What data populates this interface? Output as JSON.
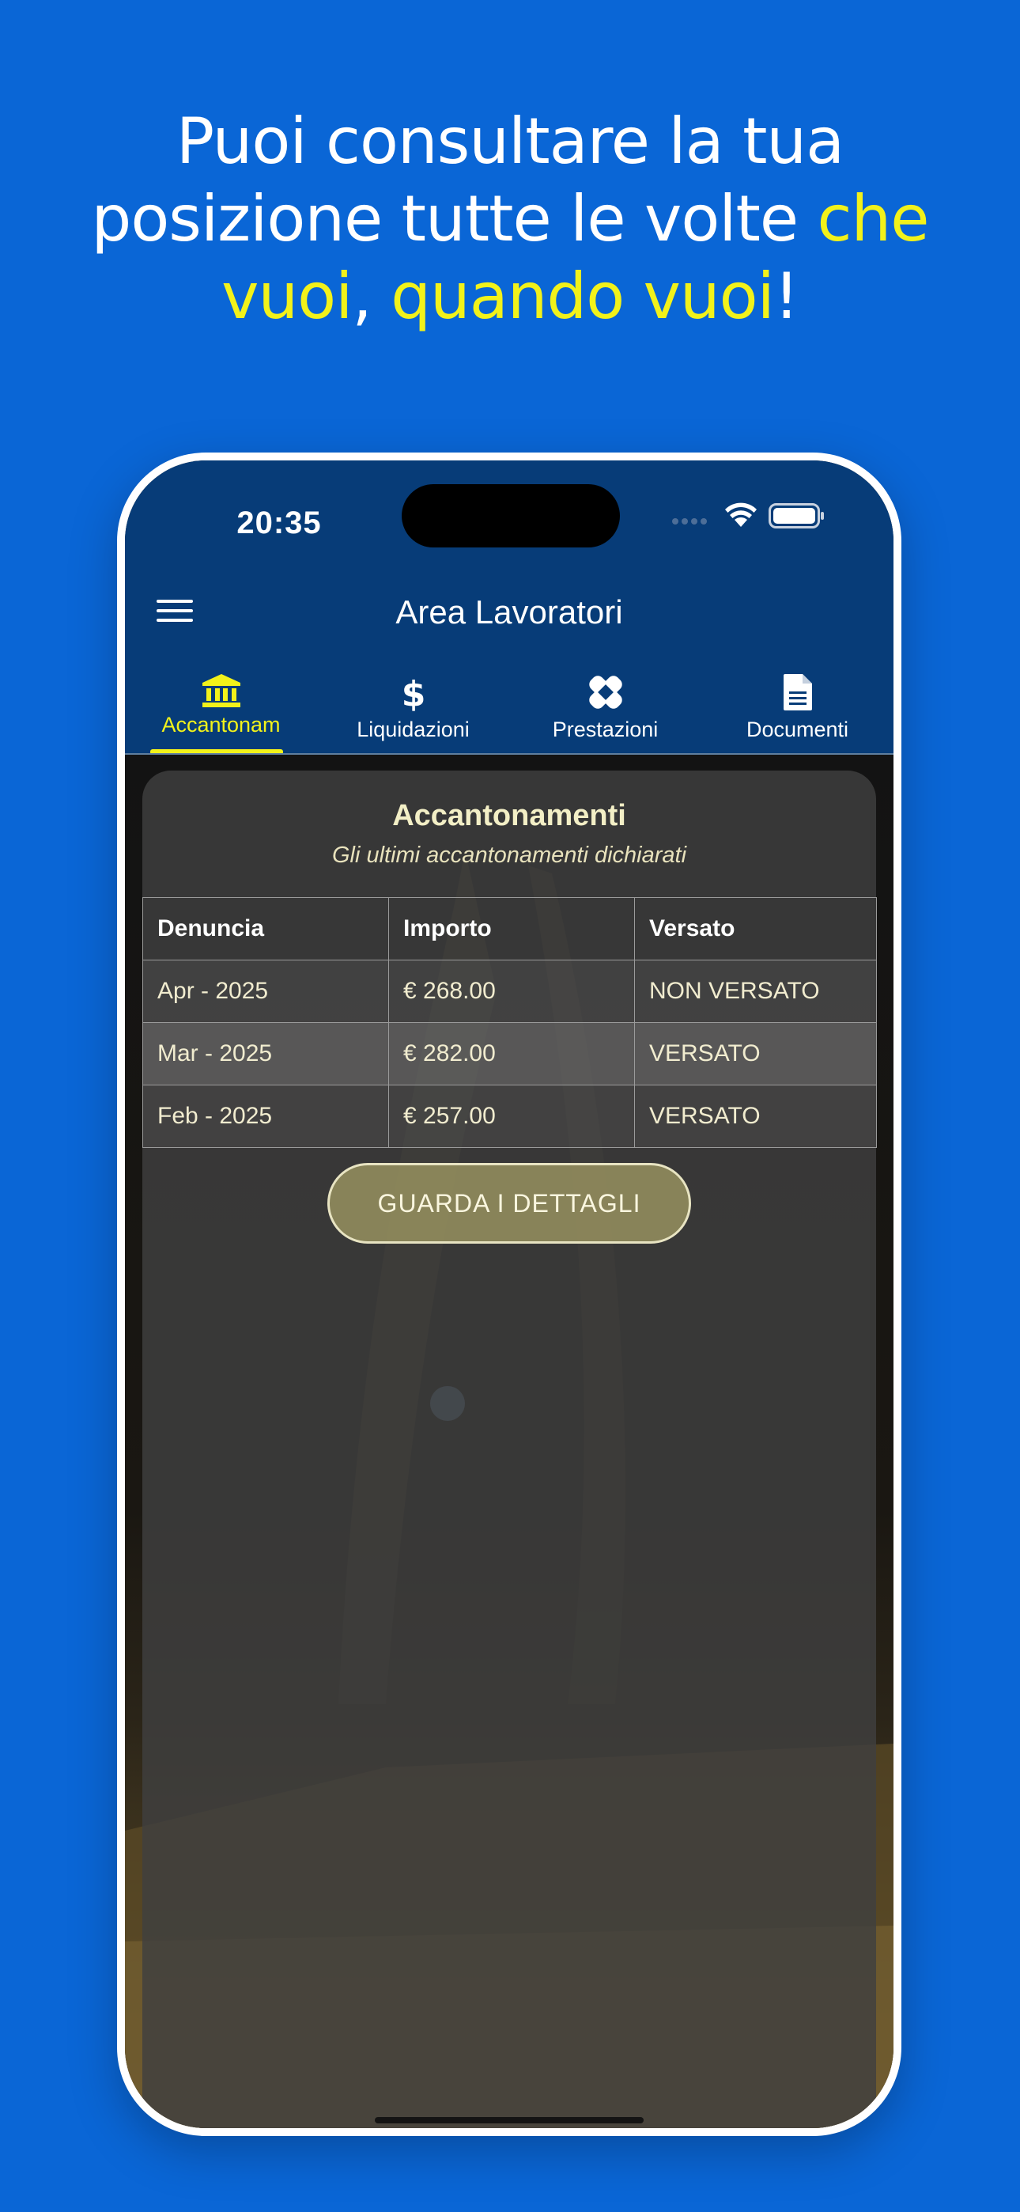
{
  "headline": {
    "line1": "Puoi consultare la tua",
    "line2_white": "posizione tutte le volte ",
    "line2_highlight": "che",
    "line3_highlight1": "vuoi",
    "line3_sep": ", ",
    "line3_highlight2": "quando vuoi",
    "line3_end": "!"
  },
  "colors": {
    "background": "#0a66d6",
    "highlight": "#f2f21a",
    "app_bar": "#073c78"
  },
  "status_bar": {
    "time": "20:35"
  },
  "app_bar": {
    "title": "Area Lavoratori",
    "menu_icon": "hamburger-menu-icon"
  },
  "tabs": [
    {
      "label": "Accantonam",
      "icon": "bank-icon",
      "active": true
    },
    {
      "label": "Liquidazioni",
      "icon": "dollar-icon",
      "active": false
    },
    {
      "label": "Prestazioni",
      "icon": "bandage-icon",
      "active": false
    },
    {
      "label": "Documenti",
      "icon": "document-icon",
      "active": false
    }
  ],
  "card": {
    "title": "Accantonamenti",
    "subtitle": "Gli ultimi accantonamenti dichiarati",
    "table": {
      "headers": [
        "Denuncia",
        "Importo",
        "Versato"
      ],
      "rows": [
        [
          "Apr - 2025",
          "€ 268.00",
          "NON VERSATO"
        ],
        [
          "Mar - 2025",
          "€ 282.00",
          "VERSATO"
        ],
        [
          "Feb - 2025",
          "€ 257.00",
          "VERSATO"
        ]
      ]
    },
    "button_label": "GUARDA I DETTAGLI"
  }
}
